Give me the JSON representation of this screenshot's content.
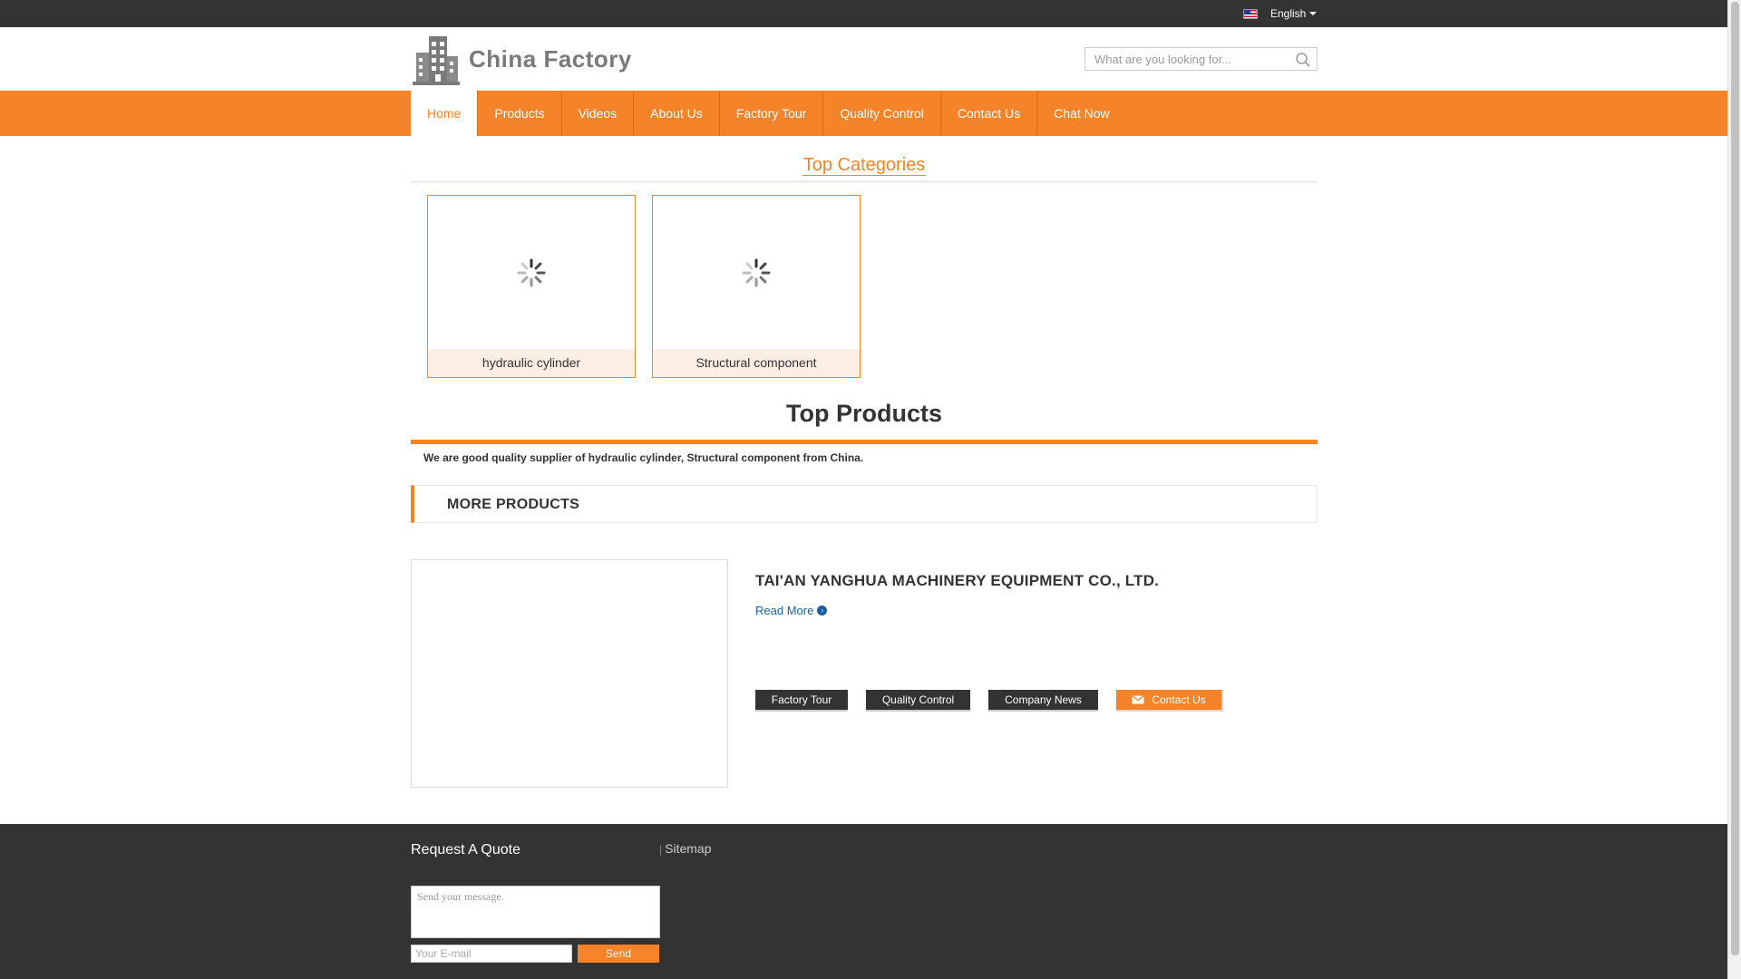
{
  "topbar": {
    "language": "English",
    "flag_icon": "us-flag-icon"
  },
  "header": {
    "logo_text": "China Factory",
    "search_placeholder": "What are you looking for..."
  },
  "nav": {
    "items": [
      {
        "label": "Home",
        "active": true
      },
      {
        "label": "Products"
      },
      {
        "label": "Videos"
      },
      {
        "label": "About Us"
      },
      {
        "label": "Factory Tour"
      },
      {
        "label": "Quality Control"
      },
      {
        "label": "Contact Us"
      },
      {
        "label": "Chat Now"
      }
    ]
  },
  "top_categories": {
    "title": "Top Categories",
    "items": [
      {
        "label": "hydraulic cylinder"
      },
      {
        "label": "Structural component"
      }
    ]
  },
  "top_products": {
    "title": "Top Products",
    "tagline": "We are good quality supplier of hydraulic cylinder, Structural component from China.",
    "more_label": "MORE PRODUCTS"
  },
  "company": {
    "name": "TAI'AN YANGHUA MACHINERY EQUIPMENT CO., LTD.",
    "read_more": "Read More",
    "buttons": {
      "factory_tour": "Factory Tour",
      "quality_control": "Quality Control",
      "company_news": "Company News",
      "contact_us": "Contact Us"
    }
  },
  "footer": {
    "request_quote": "Request A Quote",
    "sitemap": "Sitemap",
    "sitemap_separator": "|",
    "message_placeholder": "Send your message.",
    "email_placeholder": "Your E-mail",
    "send_label": "Send"
  },
  "colors": {
    "accent": "#f5832a",
    "dark": "#333333",
    "link": "#1a5e9e"
  }
}
